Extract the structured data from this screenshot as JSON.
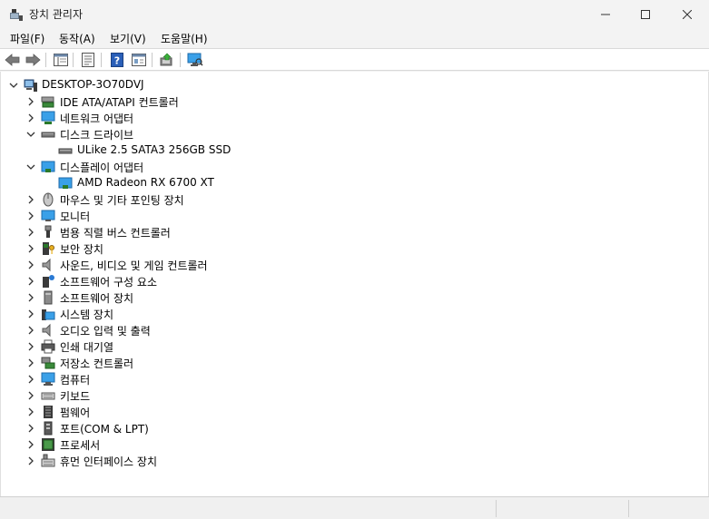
{
  "window": {
    "title": "장치 관리자"
  },
  "menu": [
    {
      "label": "파일(F)"
    },
    {
      "label": "동작(A)"
    },
    {
      "label": "보기(V)"
    },
    {
      "label": "도움말(H)"
    }
  ],
  "toolbar": {
    "icons": [
      "back-arrow-icon",
      "forward-arrow-icon",
      "properties-icon",
      "view-icon",
      "help-icon",
      "details-icon",
      "update-driver-icon",
      "scan-hardware-icon"
    ]
  },
  "tree": {
    "root": "DESKTOP-3O70DVJ",
    "items": [
      {
        "label": "IDE ATA/ATAPI 컨트롤러",
        "icon": "ide-controller-icon",
        "expanded": false
      },
      {
        "label": "네트워크 어댑터",
        "icon": "network-adapter-icon",
        "expanded": false
      },
      {
        "label": "디스크 드라이브",
        "icon": "disk-drive-icon",
        "expanded": true,
        "children": [
          "ULike 2.5 SATA3 256GB SSD"
        ]
      },
      {
        "label": "디스플레이 어댑터",
        "icon": "display-adapter-icon",
        "expanded": true,
        "children": [
          "AMD Radeon RX 6700 XT"
        ]
      },
      {
        "label": "마우스 및 기타 포인팅 장치",
        "icon": "mouse-icon",
        "expanded": false
      },
      {
        "label": "모니터",
        "icon": "monitor-icon",
        "expanded": false
      },
      {
        "label": "범용 직렬 버스 컨트롤러",
        "icon": "usb-icon",
        "expanded": false
      },
      {
        "label": "보안 장치",
        "icon": "security-device-icon",
        "expanded": false
      },
      {
        "label": "사운드, 비디오 및 게임 컨트롤러",
        "icon": "sound-icon",
        "expanded": false
      },
      {
        "label": "소프트웨어 구성 요소",
        "icon": "software-component-icon",
        "expanded": false
      },
      {
        "label": "소프트웨어 장치",
        "icon": "software-device-icon",
        "expanded": false
      },
      {
        "label": "시스템 장치",
        "icon": "system-device-icon",
        "expanded": false
      },
      {
        "label": "오디오 입력 및 출력",
        "icon": "audio-io-icon",
        "expanded": false
      },
      {
        "label": "인쇄 대기열",
        "icon": "printer-icon",
        "expanded": false
      },
      {
        "label": "저장소 컨트롤러",
        "icon": "storage-controller-icon",
        "expanded": false
      },
      {
        "label": "컴퓨터",
        "icon": "computer-icon",
        "expanded": false
      },
      {
        "label": "키보드",
        "icon": "keyboard-icon",
        "expanded": false
      },
      {
        "label": "펌웨어",
        "icon": "firmware-icon",
        "expanded": false
      },
      {
        "label": "포트(COM & LPT)",
        "icon": "port-icon",
        "expanded": false
      },
      {
        "label": "프로세서",
        "icon": "processor-icon",
        "expanded": false
      },
      {
        "label": "휴먼 인터페이스 장치",
        "icon": "hid-icon",
        "expanded": false
      }
    ]
  },
  "colors": {
    "accent": "#0078d4",
    "monitor": "#3aa0e8",
    "window_bg": "#f3f3f3"
  }
}
